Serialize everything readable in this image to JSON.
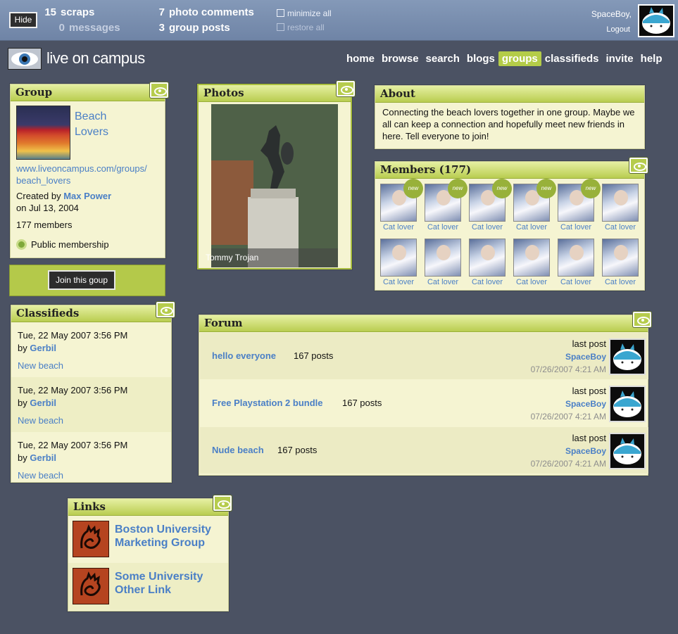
{
  "topbar": {
    "hide_label": "Hide",
    "scraps_count": "15",
    "scraps_label": "scraps",
    "messages_count": "0",
    "messages_label": "messages",
    "photo_comments_count": "7",
    "photo_comments_label": "photo comments",
    "group_posts_count": "3",
    "group_posts_label": "group posts",
    "minimize_all": "minimize all",
    "restore_all": "restore all",
    "username": "SpaceBoy,",
    "logout": "Logout"
  },
  "brand": {
    "name": "live on campus"
  },
  "nav": {
    "items": [
      "home",
      "browse",
      "search",
      "blogs",
      "groups",
      "classifieds",
      "invite",
      "help"
    ],
    "active": "groups"
  },
  "group": {
    "title": "Group",
    "name_line1": "Beach",
    "name_line2": "Lovers",
    "url_line1": "www.liveoncampus.com/groups/",
    "url_line2": "beach_lovers",
    "created_by_label": "Created by",
    "creator": "Max Power",
    "created_on": "on Jul 13, 2004",
    "members": "177 members",
    "membership": "Public membership",
    "join_label": "Join this goup"
  },
  "photos": {
    "title": "Photos",
    "caption": "Tommy Trojan"
  },
  "about": {
    "title": "About",
    "text": "Connecting the beach lovers together in one group. Maybe we all can keep a connection and hopefully meet new friends in here. Tell everyone to join!"
  },
  "members_box": {
    "title": "Members (177)",
    "new_label": "new",
    "items": [
      {
        "name": "Cat lover",
        "new": true
      },
      {
        "name": "Cat lover",
        "new": true
      },
      {
        "name": "Cat lover",
        "new": true
      },
      {
        "name": "Cat lover",
        "new": true
      },
      {
        "name": "Cat lover",
        "new": true
      },
      {
        "name": "Cat lover",
        "new": false
      },
      {
        "name": "Cat lover",
        "new": false
      },
      {
        "name": "Cat lover",
        "new": false
      },
      {
        "name": "Cat lover",
        "new": false
      },
      {
        "name": "Cat lover",
        "new": false
      },
      {
        "name": "Cat lover",
        "new": false
      },
      {
        "name": "Cat lover",
        "new": false
      }
    ]
  },
  "classifieds": {
    "title": "Classifieds",
    "items": [
      {
        "date": "Tue, 22 May 2007 3:56 PM",
        "by_label": "by",
        "author": "Gerbil",
        "title": "New beach"
      },
      {
        "date": "Tue, 22 May 2007 3:56 PM",
        "by_label": "by",
        "author": "Gerbil",
        "title": "New beach"
      },
      {
        "date": "Tue, 22 May 2007 3:56 PM",
        "by_label": "by",
        "author": "Gerbil",
        "title": "New beach"
      }
    ]
  },
  "forum": {
    "title": "Forum",
    "threads": [
      {
        "title": "hello everyone",
        "posts": "167 posts",
        "last_post_label": "last post",
        "user": "SpaceBoy",
        "date": "07/26/2007 4:21 AM"
      },
      {
        "title": "Free Playstation 2 bundle",
        "posts": "167 posts",
        "last_post_label": "last post",
        "user": "SpaceBoy",
        "date": "07/26/2007 4:21 AM"
      },
      {
        "title": "Nude beach",
        "posts": "167 posts",
        "last_post_label": "last post",
        "user": "SpaceBoy",
        "date": "07/26/2007 4:21 AM"
      }
    ]
  },
  "links": {
    "title": "Links",
    "items": [
      {
        "line1": "Boston University",
        "line2": "Marketing Group"
      },
      {
        "line1": "Some University",
        "line2": "Other Link"
      }
    ]
  }
}
